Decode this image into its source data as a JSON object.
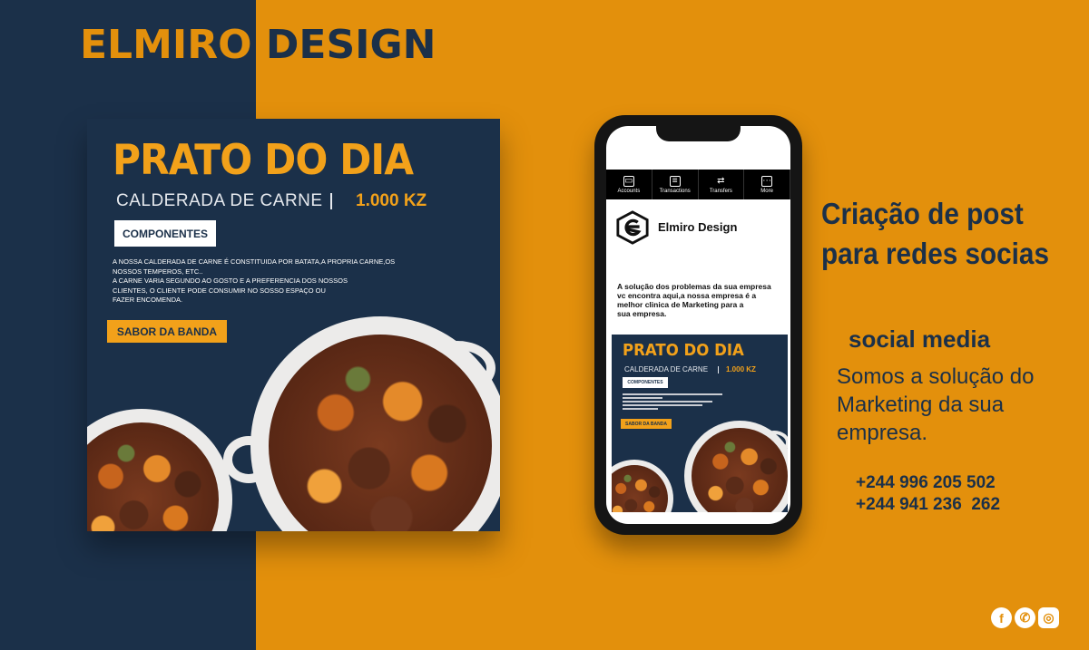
{
  "brand": {
    "part1": "ELMIRO",
    "part2": "DESIGN"
  },
  "post": {
    "title": "PRATO DO DIA",
    "subtitle": "CALDERADA DE CARNE",
    "price": "1.000 KZ",
    "components_label": "COMPONENTES",
    "description_lines": [
      "A NOSSA CALDERADA DE CARNE É CONSTITUIDA POR BATATA,A PROPRIA CARNE,OS",
      "NOSSOS TEMPEROS, ETC..",
      "A CARNE VARIA SEGUNDO AO GOSTO E A PREFERENCIA DOS NOSSOS",
      "CLIENTES, O CLIENTE PODE CONSUMIR NO SOSSO ESPAÇO OU",
      "FAZER ENCOMENDA."
    ],
    "tag": "SABOR DA BANDA"
  },
  "phone": {
    "tabs": [
      {
        "label": "Accounts",
        "icon": "card-icon"
      },
      {
        "label": "Transactions",
        "icon": "list-icon"
      },
      {
        "label": "Transfers",
        "icon": "swap-icon"
      },
      {
        "label": "More",
        "icon": "more-icon"
      }
    ],
    "profile_name": "Elmiro Design",
    "profile_desc_lines": [
      "A solução dos problemas da sua empresa",
      "vc encontra aqui,a nossa empresa é a",
      "melhor clinica de Marketing para a",
      "sua empresa."
    ]
  },
  "headline": {
    "line1": "Criação de post",
    "line2": "para redes socias"
  },
  "social_media": {
    "label": "social media",
    "text_lines": [
      "Somos a solução do",
      "Marketing da sua",
      "empresa."
    ]
  },
  "contacts": {
    "phone1": "+244 996 205 502",
    "phone2": "+244 941 236  262"
  },
  "socials": [
    {
      "name": "facebook-icon",
      "glyph": "f"
    },
    {
      "name": "whatsapp-icon",
      "glyph": "✆"
    },
    {
      "name": "instagram-icon",
      "glyph": "◎"
    }
  ],
  "colors": {
    "navy": "#1b3049",
    "orange": "#e3900c",
    "accent": "#f2a11a"
  }
}
